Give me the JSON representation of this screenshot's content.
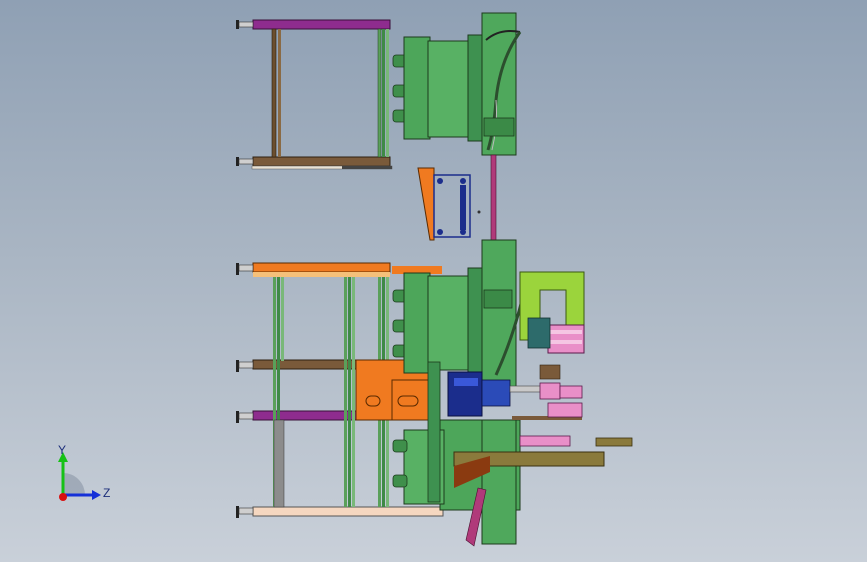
{
  "view": {
    "background": "#a3afbf",
    "triad": {
      "y_label": "Y",
      "z_label": "Z",
      "y_color": "#16c116",
      "z_color": "#1530d8",
      "origin_color": "#d81010"
    }
  },
  "model": {
    "colors": {
      "green": "#4da65a",
      "dark_green": "#2f7e3c",
      "purple": "#8e2c8e",
      "brown": "#7a5a3a",
      "orange": "#f07a20",
      "lime": "#9bd43c",
      "pink": "#e98fc8",
      "navy": "#1b2d8c",
      "olive": "#8a7a3c",
      "magenta": "#b03a7a",
      "peach": "#f5d7c0"
    }
  }
}
